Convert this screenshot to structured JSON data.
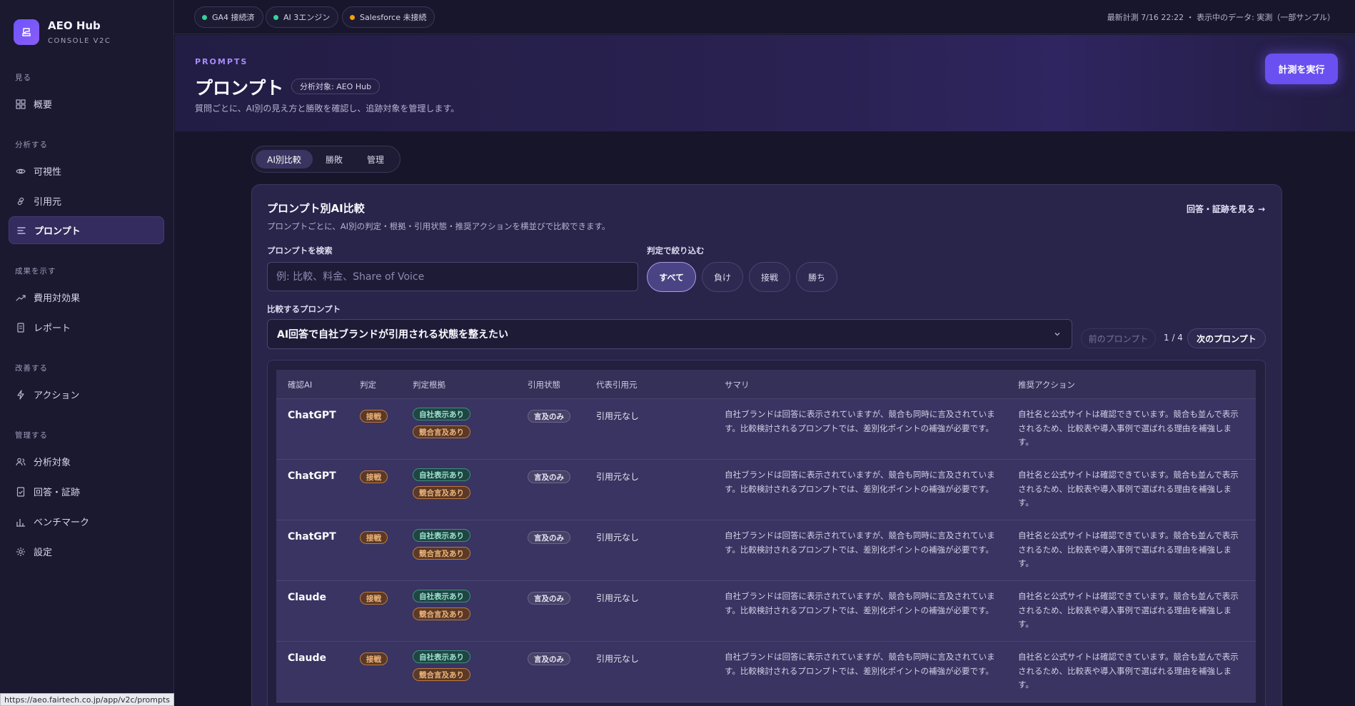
{
  "brand": {
    "name": "AEO Hub",
    "sub": "CONSOLE V2C"
  },
  "sidebar": {
    "groups": [
      {
        "label": "見る",
        "items": [
          {
            "label": "概要",
            "icon": "grid-icon"
          }
        ]
      },
      {
        "label": "分析する",
        "items": [
          {
            "label": "可視性",
            "icon": "eye-icon"
          },
          {
            "label": "引用元",
            "icon": "link-icon"
          },
          {
            "label": "プロンプト",
            "icon": "list-icon",
            "active": true
          }
        ]
      },
      {
        "label": "成果を示す",
        "items": [
          {
            "label": "費用対効果",
            "icon": "trend-icon"
          },
          {
            "label": "レポート",
            "icon": "document-icon"
          }
        ]
      },
      {
        "label": "改善する",
        "items": [
          {
            "label": "アクション",
            "icon": "bolt-icon"
          }
        ]
      },
      {
        "label": "管理する",
        "items": [
          {
            "label": "分析対象",
            "icon": "users-icon"
          },
          {
            "label": "回答・証跡",
            "icon": "file-check-icon"
          },
          {
            "label": "ベンチマーク",
            "icon": "bar-chart-icon"
          },
          {
            "label": "設定",
            "icon": "gear-icon"
          }
        ]
      }
    ]
  },
  "topbar": {
    "chips": [
      {
        "label": "GA4 接続済",
        "color": "#34d399"
      },
      {
        "label": "AI 3エンジン",
        "color": "#34d399"
      },
      {
        "label": "Salesforce 未接続",
        "color": "#f59e0b"
      }
    ],
    "status": "最新計測 7/16 22:22 ・ 表示中のデータ: 実測（一部サンプル）"
  },
  "header": {
    "eyebrow": "PROMPTS",
    "title": "プロンプト",
    "scope": "分析対象: AEO Hub",
    "description": "質問ごとに、AI別の見え方と勝敗を確認し、追跡対象を管理します。",
    "run_button": "計測を実行"
  },
  "tabs": [
    {
      "label": "AI別比較",
      "active": true
    },
    {
      "label": "勝敗"
    },
    {
      "label": "管理"
    }
  ],
  "card": {
    "title": "プロンプト別AI比較",
    "description": "プロンプトごとに、AI別の判定・根拠・引用状態・推奨アクションを横並びで比較できます。",
    "evidence_link": "回答・証跡を見る →",
    "search_label": "プロンプトを検索",
    "search_placeholder": "例: 比較、料金、Share of Voice",
    "filter_label": "判定で絞り込む",
    "filters": [
      {
        "label": "すべて",
        "active": true
      },
      {
        "label": "負け"
      },
      {
        "label": "接戦"
      },
      {
        "label": "勝ち"
      }
    ],
    "select_label": "比較するプロンプト",
    "selected_prompt": "AI回答で自社ブランドが引用される状態を整えたい",
    "prev_button": "前のプロンプト",
    "pager": "1 / 4",
    "next_button": "次のプロンプト"
  },
  "table": {
    "headers": [
      "確認AI",
      "判定",
      "判定根拠",
      "引用状態",
      "代表引用元",
      "サマリ",
      "推奨アクション"
    ],
    "rows": [
      {
        "ai": "ChatGPT",
        "verdict": "接戦",
        "reasons": [
          "自社表示あり",
          "競合言及あり"
        ],
        "citation": "言及のみ",
        "source": "引用元なし",
        "summary": "自社ブランドは回答に表示されていますが、競合も同時に言及されています。比較検討されるプロンプトでは、差別化ポイントの補強が必要です。",
        "action": "自社名と公式サイトは確認できています。競合も並んで表示されるため、比較表や導入事例で選ばれる理由を補強します。"
      },
      {
        "ai": "ChatGPT",
        "verdict": "接戦",
        "reasons": [
          "自社表示あり",
          "競合言及あり"
        ],
        "citation": "言及のみ",
        "source": "引用元なし",
        "summary": "自社ブランドは回答に表示されていますが、競合も同時に言及されています。比較検討されるプロンプトでは、差別化ポイントの補強が必要です。",
        "action": "自社名と公式サイトは確認できています。競合も並んで表示されるため、比較表や導入事例で選ばれる理由を補強します。"
      },
      {
        "ai": "ChatGPT",
        "verdict": "接戦",
        "reasons": [
          "自社表示あり",
          "競合言及あり"
        ],
        "citation": "言及のみ",
        "source": "引用元なし",
        "summary": "自社ブランドは回答に表示されていますが、競合も同時に言及されています。比較検討されるプロンプトでは、差別化ポイントの補強が必要です。",
        "action": "自社名と公式サイトは確認できています。競合も並んで表示されるため、比較表や導入事例で選ばれる理由を補強します。"
      },
      {
        "ai": "Claude",
        "verdict": "接戦",
        "reasons": [
          "自社表示あり",
          "競合言及あり"
        ],
        "citation": "言及のみ",
        "source": "引用元なし",
        "summary": "自社ブランドは回答に表示されていますが、競合も同時に言及されています。比較検討されるプロンプトでは、差別化ポイントの補強が必要です。",
        "action": "自社名と公式サイトは確認できています。競合も並んで表示されるため、比較表や導入事例で選ばれる理由を補強します。"
      },
      {
        "ai": "Claude",
        "verdict": "接戦",
        "reasons": [
          "自社表示あり",
          "競合言及あり"
        ],
        "citation": "言及のみ",
        "source": "引用元なし",
        "summary": "自社ブランドは回答に表示されていますが、競合も同時に言及されています。比較検討されるプロンプトでは、差別化ポイントの補強が必要です。",
        "action": "自社名と公式サイトは確認できています。競合も並んで表示されるため、比較表や導入事例で選ばれる理由を補強します。"
      }
    ]
  },
  "status_url": "https://aeo.fairtech.co.jp/app/v2c/prompts"
}
